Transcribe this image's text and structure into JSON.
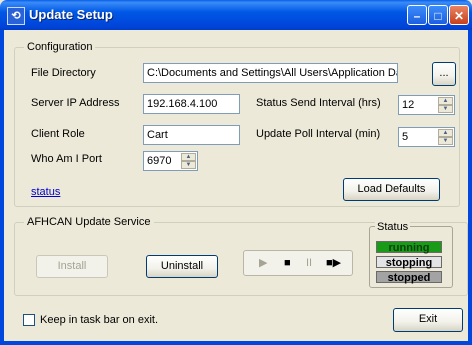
{
  "window": {
    "title": "Update Setup",
    "minimize": "–",
    "maximize": "□",
    "close": "✕"
  },
  "configuration": {
    "label": "Configuration",
    "file_directory_label": "File Directory",
    "file_directory_value": "C:\\Documents and Settings\\All Users\\Application Data\\afh",
    "browse_label": "...",
    "server_ip_label": "Server IP Address",
    "server_ip_value": "192.168.4.100",
    "status_send_interval_label": "Status Send Interval (hrs)",
    "status_send_interval_value": "12",
    "client_role_label": "Client Role",
    "client_role_value": "Cart",
    "update_poll_interval_label": "Update Poll Interval (min)",
    "update_poll_interval_value": "5",
    "who_am_i_port_label": "Who Am I Port",
    "who_am_i_port_value": "6970",
    "status_link": "status",
    "load_defaults_label": "Load Defaults"
  },
  "service": {
    "label": "AFHCAN Update Service",
    "install_label": "Install",
    "uninstall_label": "Uninstall",
    "media": {
      "play": "▶",
      "stop": "■",
      "pause": "II",
      "step": "■▶"
    },
    "status": {
      "label": "Status",
      "running": "running",
      "stopping": "stopping",
      "stopped": "stopped"
    }
  },
  "footer": {
    "keep_in_taskbar_label": "Keep in task bar on exit.",
    "keep_in_taskbar_checked": false,
    "exit_label": "Exit"
  },
  "colors": {
    "running": "#199a19",
    "stopping": "#e4e4e4",
    "stopped": "#a3a3a3"
  }
}
